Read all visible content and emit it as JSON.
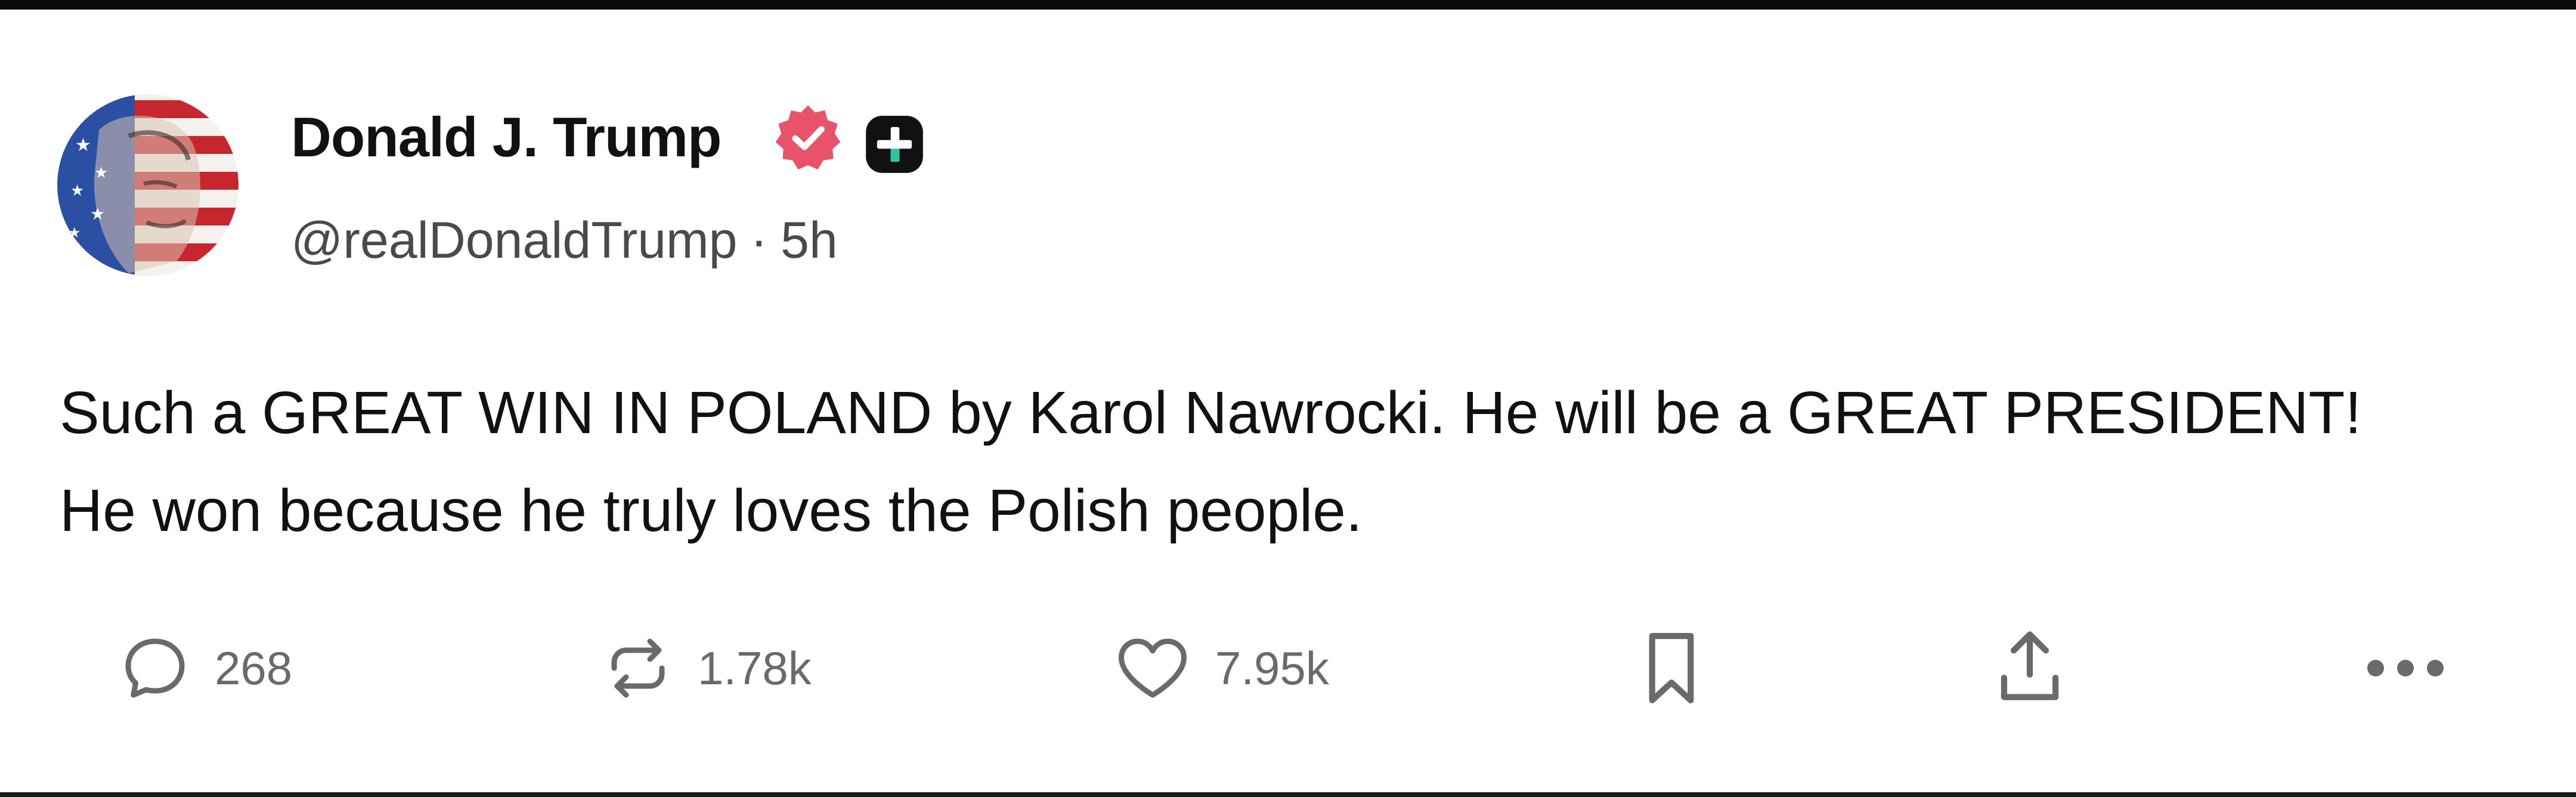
{
  "post": {
    "author": {
      "display_name": "Donald J. Trump",
      "handle": "@realDonaldTrump",
      "verified_badge_icon": "verified-check-icon",
      "extra_badge_icon": "plus-badge-icon"
    },
    "separator": "·",
    "age": "5h",
    "body": "Such a GREAT WIN IN POLAND by Karol Nawrocki. He will be a GREAT PRESIDENT! He won because he truly loves the Polish people.",
    "actions": {
      "reply": {
        "icon": "comment-icon",
        "count": "268"
      },
      "repost": {
        "icon": "repost-icon",
        "count": "1.78k"
      },
      "like": {
        "icon": "heart-icon",
        "count": "7.95k"
      },
      "bookmark": {
        "icon": "bookmark-icon"
      },
      "share": {
        "icon": "share-icon"
      },
      "more": {
        "icon": "more-dots-icon"
      }
    }
  },
  "colors": {
    "verified_badge": "#e8536b",
    "icon_gray": "#6a6a6a",
    "text_primary": "#111111",
    "text_secondary": "#4a4a4a"
  }
}
